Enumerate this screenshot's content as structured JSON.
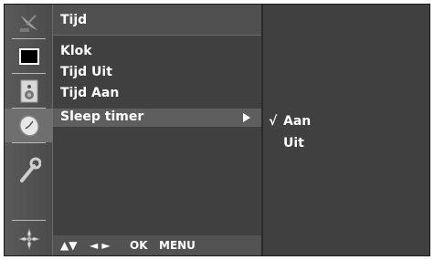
{
  "menu": {
    "title": "Tijd",
    "items": [
      {
        "label": "Klok"
      },
      {
        "label": "Tijd Uit"
      },
      {
        "label": "Tijd Aan"
      },
      {
        "label": "Sleep timer",
        "selected": true
      }
    ]
  },
  "help": {
    "updown": "▲▼",
    "leftright": "◄ ►",
    "ok": "OK",
    "menu": "MENU"
  },
  "submenu": {
    "items": [
      {
        "label": "Aan",
        "checked": true
      },
      {
        "label": "Uit",
        "checked": false
      }
    ],
    "check_mark": "√"
  },
  "sidebar": {
    "icons": [
      "satellite-dish-icon",
      "screen-icon",
      "speaker-icon",
      "clock-icon",
      "wrench-icon",
      "options-icon"
    ],
    "active_index": 2
  }
}
